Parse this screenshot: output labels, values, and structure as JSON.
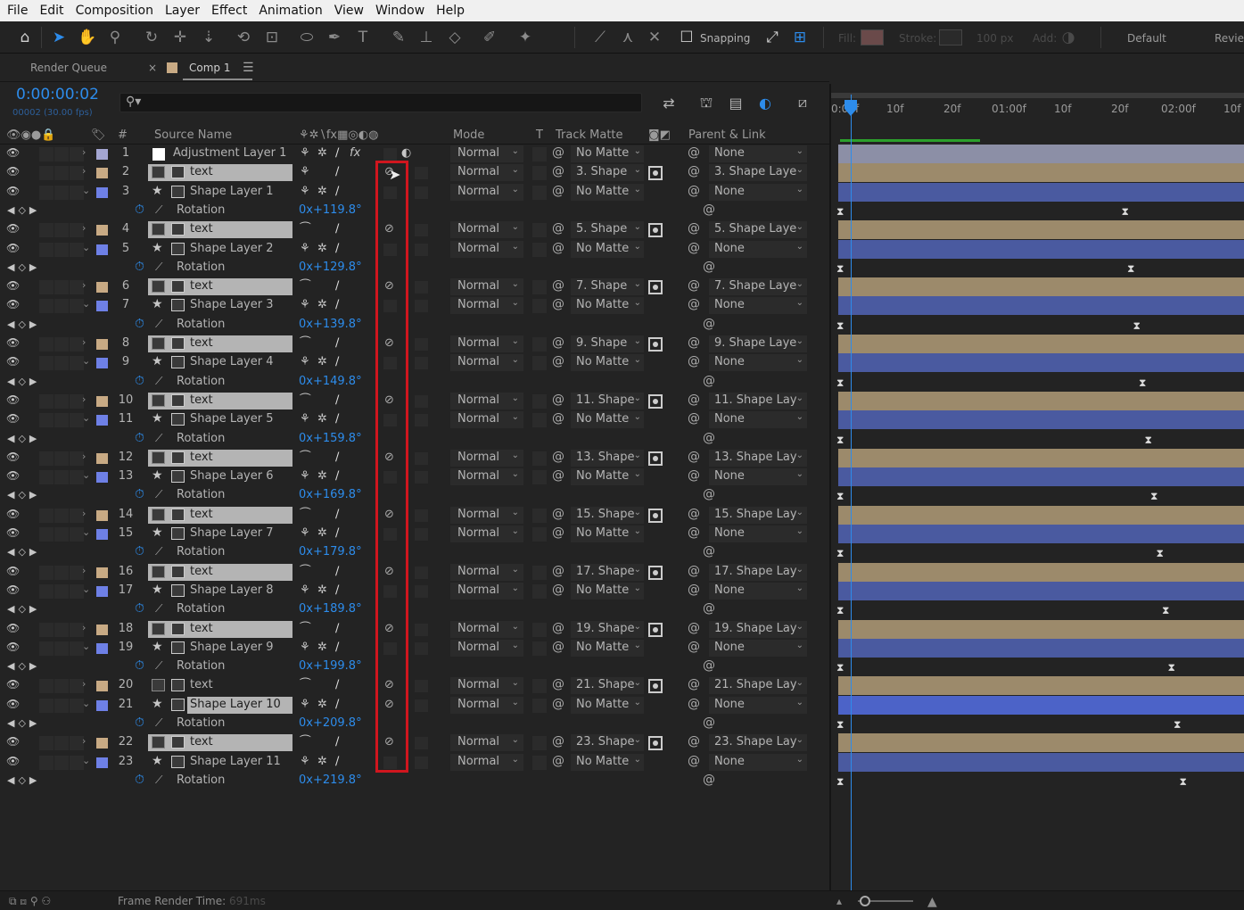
{
  "menu": [
    "File",
    "Edit",
    "Composition",
    "Layer",
    "Effect",
    "Animation",
    "View",
    "Window",
    "Help"
  ],
  "toolbar": {
    "snapping_label": "Snapping",
    "fill_label": "Fill:",
    "stroke_label": "Stroke:",
    "stroke_width": "100 px",
    "add_label": "Add:",
    "workspace": "Default",
    "review": "Revie"
  },
  "tabs": {
    "render_queue": "Render Queue",
    "comp": "Comp 1",
    "menu_glyph": "☰",
    "close_glyph": "×"
  },
  "timecode": {
    "value": "0:00:00:02",
    "frames_fps": "00002 (30.00 fps)"
  },
  "search": {
    "icon_glyph": "⚲▾"
  },
  "columns": {
    "hash": "#",
    "source_name": "Source Name",
    "mode": "Mode",
    "t": "T",
    "track_matte": "Track Matte",
    "parent_link": "Parent & Link"
  },
  "colors": {
    "accent": "#2d8ceb",
    "label_tan": "#c8aa84",
    "label_blue": "#6e80e6",
    "label_lavender": "#a4a6d2",
    "highlight": "#d0161e",
    "tan_bar": "#9c8a6b",
    "blue_bar": "#4a5aa0"
  },
  "layers": [
    {
      "num": "1",
      "name": "Adjustment Layer 1",
      "kind": "adjust",
      "mode": "Normal",
      "matte": "No Matte",
      "parent": "None"
    },
    {
      "num": "2",
      "name": "text",
      "kind": "text",
      "mode": "Normal",
      "matte": "3. Shape",
      "parent": "3. Shape Laye"
    },
    {
      "num": "3",
      "name": "Shape Layer 1",
      "kind": "shape",
      "mode": "Normal",
      "matte": "No Matte",
      "parent": "None",
      "rot": "0x+119.8°"
    },
    {
      "num": "4",
      "name": "text",
      "kind": "text",
      "mode": "Normal",
      "matte": "5. Shape",
      "parent": "5. Shape Laye"
    },
    {
      "num": "5",
      "name": "Shape Layer 2",
      "kind": "shape",
      "mode": "Normal",
      "matte": "No Matte",
      "parent": "None",
      "rot": "0x+129.8°"
    },
    {
      "num": "6",
      "name": "text",
      "kind": "text",
      "mode": "Normal",
      "matte": "7. Shape",
      "parent": "7. Shape Laye"
    },
    {
      "num": "7",
      "name": "Shape Layer 3",
      "kind": "shape",
      "mode": "Normal",
      "matte": "No Matte",
      "parent": "None",
      "rot": "0x+139.8°"
    },
    {
      "num": "8",
      "name": "text",
      "kind": "text",
      "mode": "Normal",
      "matte": "9. Shape",
      "parent": "9. Shape Laye"
    },
    {
      "num": "9",
      "name": "Shape Layer 4",
      "kind": "shape",
      "mode": "Normal",
      "matte": "No Matte",
      "parent": "None",
      "rot": "0x+149.8°"
    },
    {
      "num": "10",
      "name": "text",
      "kind": "text",
      "mode": "Normal",
      "matte": "11. Shape",
      "parent": "11. Shape Lay"
    },
    {
      "num": "11",
      "name": "Shape Layer 5",
      "kind": "shape",
      "mode": "Normal",
      "matte": "No Matte",
      "parent": "None",
      "rot": "0x+159.8°"
    },
    {
      "num": "12",
      "name": "text",
      "kind": "text",
      "mode": "Normal",
      "matte": "13. Shape",
      "parent": "13. Shape Lay"
    },
    {
      "num": "13",
      "name": "Shape Layer 6",
      "kind": "shape",
      "mode": "Normal",
      "matte": "No Matte",
      "parent": "None",
      "rot": "0x+169.8°"
    },
    {
      "num": "14",
      "name": "text",
      "kind": "text",
      "mode": "Normal",
      "matte": "15. Shape",
      "parent": "15. Shape Lay"
    },
    {
      "num": "15",
      "name": "Shape Layer 7",
      "kind": "shape",
      "mode": "Normal",
      "matte": "No Matte",
      "parent": "None",
      "rot": "0x+179.8°"
    },
    {
      "num": "16",
      "name": "text",
      "kind": "text",
      "mode": "Normal",
      "matte": "17. Shape",
      "parent": "17. Shape Lay"
    },
    {
      "num": "17",
      "name": "Shape Layer 8",
      "kind": "shape",
      "mode": "Normal",
      "matte": "No Matte",
      "parent": "None",
      "rot": "0x+189.8°"
    },
    {
      "num": "18",
      "name": "text",
      "kind": "text",
      "mode": "Normal",
      "matte": "19. Shape",
      "parent": "19. Shape Lay"
    },
    {
      "num": "19",
      "name": "Shape Layer 9",
      "kind": "shape",
      "mode": "Normal",
      "matte": "No Matte",
      "parent": "None",
      "rot": "0x+199.8°"
    },
    {
      "num": "20",
      "name": "text",
      "kind": "text",
      "mode": "Normal",
      "matte": "21. Shape",
      "parent": "21. Shape Lay",
      "unselected": true
    },
    {
      "num": "21",
      "name": "Shape Layer 10",
      "kind": "shape",
      "mode": "Normal",
      "matte": "No Matte",
      "parent": "None",
      "rot": "0x+209.8°",
      "selected": true
    },
    {
      "num": "22",
      "name": "text",
      "kind": "text",
      "mode": "Normal",
      "matte": "23. Shape",
      "parent": "23. Shape Lay"
    },
    {
      "num": "23",
      "name": "Shape Layer 11",
      "kind": "shape",
      "mode": "Normal",
      "matte": "No Matte",
      "parent": "None",
      "rot": "0x+219.8°"
    }
  ],
  "property_label": "Rotation",
  "ruler": [
    "0:00f",
    "10f",
    "20f",
    "01:00f",
    "10f",
    "20f",
    "02:00f",
    "10f"
  ],
  "status": {
    "label": "Frame Render Time:",
    "value": "691ms"
  }
}
